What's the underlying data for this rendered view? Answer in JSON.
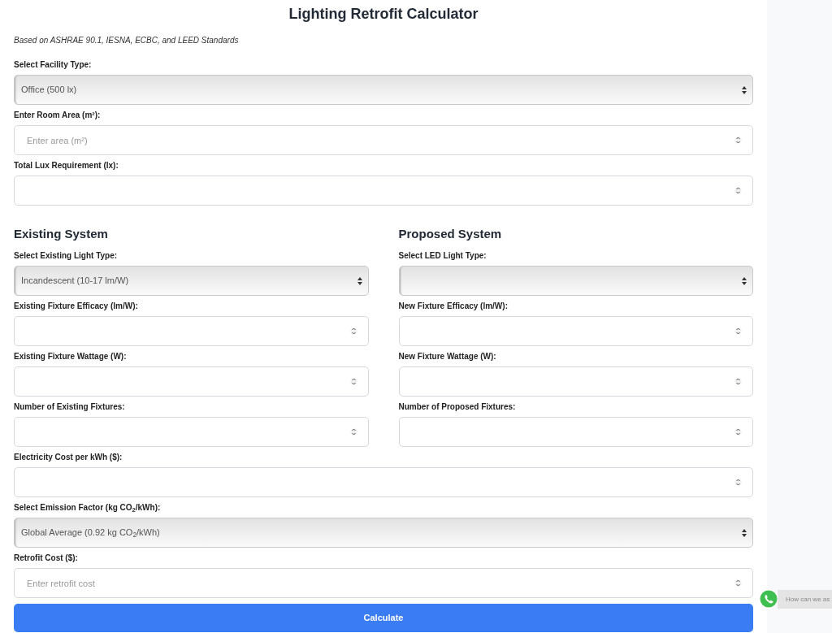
{
  "title": "Lighting Retrofit Calculator",
  "subtitle": "Based on ASHRAE 90.1, IESNA, ECBC, and LEED Standards",
  "top_fields": [
    {
      "label": "Select Facility Type:",
      "kind": "select",
      "value": "Office (500 lx)"
    },
    {
      "label": "Enter Room Area (m²):",
      "kind": "number",
      "placeholder": "Enter area (m²)"
    },
    {
      "label": "Total Lux Requirement (lx):",
      "kind": "number"
    }
  ],
  "columns": [
    {
      "heading": "Existing System",
      "fields": [
        {
          "label": "Select Existing Light Type:",
          "kind": "select",
          "value": "Incandescent (10-17 lm/W)"
        },
        {
          "label": "Existing Fixture Efficacy (lm/W):",
          "kind": "number"
        },
        {
          "label": "Existing Fixture Wattage (W):",
          "kind": "number"
        },
        {
          "label": "Number of Existing Fixtures:",
          "kind": "number"
        }
      ]
    },
    {
      "heading": "Proposed System",
      "fields": [
        {
          "label": "Select LED Light Type:",
          "kind": "select"
        },
        {
          "label": "New Fixture Efficacy (lm/W):",
          "kind": "number"
        },
        {
          "label": "New Fixture Wattage (W):",
          "kind": "number"
        },
        {
          "label": "Number of Proposed Fixtures:",
          "kind": "number"
        }
      ]
    }
  ],
  "bottom_fields": [
    {
      "label": "Electricity Cost per kWh ($):",
      "kind": "number"
    },
    {
      "label": "Select Emission Factor (kg CO$_{2}$/kWh):",
      "kind": "select",
      "value": "Global Average (0.92 kg CO$_{2}$/kWh)"
    },
    {
      "label": "Retrofit Cost ($):",
      "kind": "number",
      "placeholder": "Enter retrofit cost"
    }
  ],
  "button": "Calculate",
  "chat_widget": {
    "text": "How can we as"
  }
}
